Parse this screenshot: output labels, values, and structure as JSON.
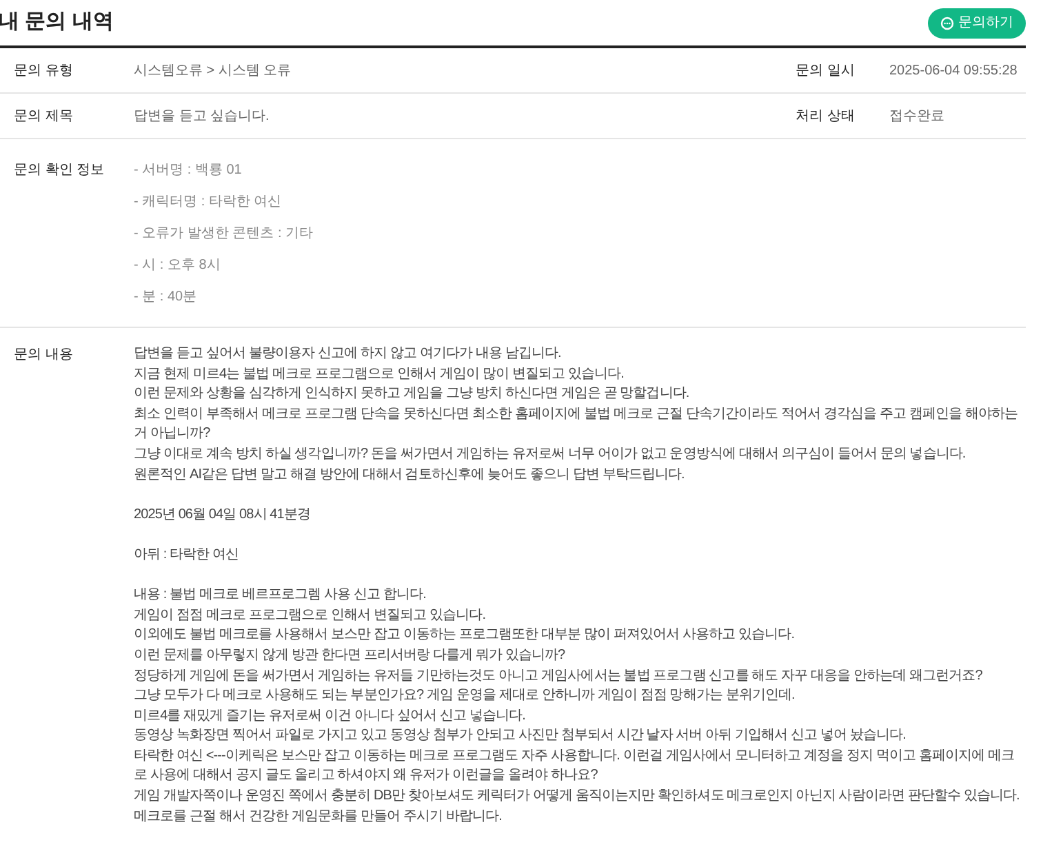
{
  "page_title": "내 문의 내역",
  "inquire_button": {
    "label": "문의하기"
  },
  "summary_rows": [
    {
      "label": "문의 유형",
      "value": "시스템오류 > 시스템 오류",
      "side_label": "문의 일시",
      "side_value": "2025-06-04 09:55:28"
    },
    {
      "label": "문의 제목",
      "value": "답변을 듣고 싶습니다.",
      "side_label": "처리 상태",
      "side_value": "접수완료"
    }
  ],
  "confirm_info": {
    "label": "문의 확인 정보",
    "items": [
      "- 서버명 : 백룡 01",
      "- 캐릭터명 : 타락한 여신",
      "- 오류가 발생한 콘텐츠 : 기타",
      "- 시 : 오후 8시",
      "- 분 : 40분"
    ]
  },
  "content": {
    "label": "문의 내용",
    "blocks": [
      [
        "답변을 듣고 싶어서 불량이용자 신고에 하지 않고 여기다가 내용 남깁니다.",
        "지금 현제 미르4는 불법 메크로 프로그램으로 인해서 게임이 많이 변질되고 있습니다.",
        "이런 문제와 상황을 심각하게 인식하지 못하고 게임을 그냥 방치 하신다면 게임은 곧 망할겁니다.",
        "최소 인력이 부족해서 메크로 프로그램 단속을 못하신다면 최소한 홈페이지에 불법 메크로 근절 단속기간이라도 적어서 경각심을 주고 캠페인을 해야하는거 아닙니까?",
        "그냥 이대로 계속 방치 하실 생각입니까? 돈을 써가면서 게임하는 유저로써 너무 어이가 없고 운영방식에 대해서 의구심이 들어서 문의 넣습니다.",
        "원론적인 AI같은 답변 말고 해결 방안에 대해서 검토하신후에 늦어도 좋으니 답변 부탁드립니다."
      ],
      [
        "2025년 06월 04일 08시 41분경"
      ],
      [
        "아뒤 : 타락한 여신"
      ],
      [
        "내용 : 불법 메크로 베르프로그렘 사용 신고 합니다.",
        "게임이 점점 메크로 프로그램으로 인해서 변질되고 있습니다.",
        "이외에도 불법 메크로를 사용해서 보스만 잡고 이동하는 프로그램또한 대부분 많이 퍼져있어서 사용하고 있습니다.",
        "이런 문제를 아무렇지 않게 방관 한다면 프리서버랑 다를게 뭐가 있습니까?",
        "정당하게 게임에 돈을 써가면서 게임하는 유저들 기만하는것도 아니고 게임사에서는 불법 프로그램 신고를 해도 자꾸 대응을 안하는데 왜그런거죠?",
        "그냥 모두가 다 메크로 사용해도 되는 부분인가요? 게임 운영을 제대로 안하니까 게임이 점점 망해가는 분위기인데.",
        "미르4를 재밌게 즐기는 유저로써 이건 아니다 싶어서 신고 넣습니다.",
        "동영상 녹화장면 찍어서 파일로 가지고 있고 동영상 첨부가 안되고 사진만 첨부되서 시간 날자 서버 아뒤 기입해서 신고 넣어 놨습니다.",
        "타락한 여신 <---이케릭은 보스만 잡고 이동하는 메크로 프로그램도 자주 사용합니다. 이런걸 게임사에서 모니터하고 계정을 정지 먹이고 홈페이지에 메크로 사용에 대해서 공지 글도 올리고 하셔야지 왜 유저가 이런글을 올려야 하나요?",
        "게임 개발자쪽이나 운영진 쪽에서 충분히 DB만 찾아보셔도 케릭터가 어떻게 움직이는지만 확인하셔도 메크로인지 아닌지 사람이라면 판단할수 있습니다. 메크로를 근절 해서 건강한 게임문화를 만들어 주시기 바랍니다."
      ]
    ]
  }
}
